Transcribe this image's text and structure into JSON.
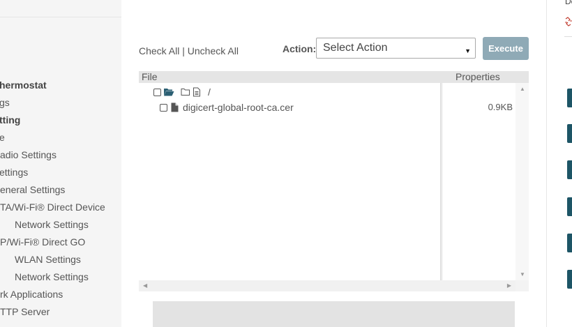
{
  "sidebar": {
    "items": [
      {
        "label": "hermostat",
        "bold": true
      },
      {
        "label": "gs",
        "bold": false
      },
      {
        "label": "tting",
        "bold": true
      },
      {
        "label": "e",
        "bold": false
      },
      {
        "label": "adio Settings",
        "bold": false
      },
      {
        "label": "ettings",
        "bold": false
      },
      {
        "label": "eneral Settings",
        "bold": false
      },
      {
        "label": "TA/Wi-Fi® Direct Device",
        "bold": false
      },
      {
        "label": "Network Settings",
        "bold": false
      },
      {
        "label": "P/Wi-Fi® Direct GO",
        "bold": false
      },
      {
        "label": "WLAN Settings",
        "bold": false
      },
      {
        "label": "Network Settings",
        "bold": false
      },
      {
        "label": "rk Applications",
        "bold": false
      },
      {
        "label": "TTP Server",
        "bold": false
      }
    ]
  },
  "toolbar": {
    "check_all": "Check All",
    "separator": " | ",
    "uncheck_all": "Uncheck All",
    "action_label": "Action:",
    "action_selected": "Select Action",
    "execute_label": "Execute"
  },
  "file_table": {
    "columns": {
      "file": "File",
      "properties": "Properties"
    },
    "root": {
      "name": "/"
    },
    "files": [
      {
        "name": "digicert-global-root-ca.cer",
        "size": "0.9KB"
      }
    ]
  },
  "right_panel": {
    "partial_text": "De"
  },
  "colors": {
    "accent_red": "#e02020",
    "execute_button": "#8faab6",
    "folder_icon": "#2b5f73",
    "side_button": "#1d5566"
  }
}
